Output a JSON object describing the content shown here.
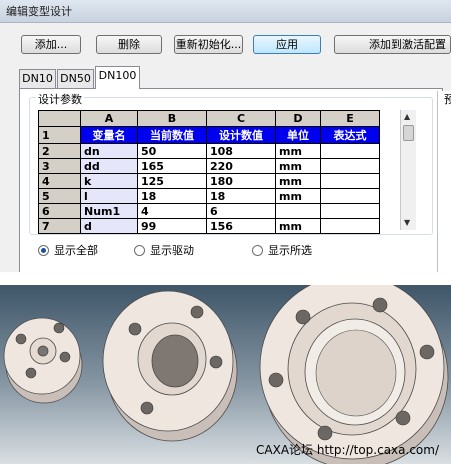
{
  "window": {
    "title": "编辑变型设计"
  },
  "toolbar": {
    "add_label": "添加...",
    "delete_label": "删除",
    "reinit_label": "重新初始化...",
    "apply_label": "应用",
    "add_to_active_label": "添加到激活配置"
  },
  "tabs": [
    "DN10",
    "DN50",
    "DN100"
  ],
  "active_tab": "DN100",
  "panel": {
    "group_label": "设计参数",
    "preview_label": "预"
  },
  "grid": {
    "columns": [
      "A",
      "B",
      "C",
      "D",
      "E"
    ],
    "header_row": {
      "index": "1",
      "cells": [
        "变量名",
        "当前数值",
        "设计数值",
        "单位",
        "表达式"
      ]
    },
    "rows": [
      {
        "index": "2",
        "cells": [
          "dn",
          "50",
          "108",
          "mm",
          ""
        ]
      },
      {
        "index": "3",
        "cells": [
          "dd",
          "165",
          "220",
          "mm",
          ""
        ]
      },
      {
        "index": "4",
        "cells": [
          "k",
          "125",
          "180",
          "mm",
          ""
        ]
      },
      {
        "index": "5",
        "cells": [
          "l",
          "18",
          "18",
          "mm",
          ""
        ]
      },
      {
        "index": "6",
        "cells": [
          "Num1",
          "4",
          "6",
          "",
          ""
        ]
      },
      {
        "index": "7",
        "cells": [
          "d",
          "99",
          "156",
          "mm",
          ""
        ]
      }
    ]
  },
  "display_options": {
    "show_all": "显示全部",
    "show_driven": "显示驱动",
    "show_selected": "显示所选",
    "selected": "show_all"
  },
  "caption": "CAXA论坛 http://top.caxa.com/",
  "colors": {
    "header_blue": "#0000ee",
    "flange_fill": "#efe6df",
    "flange_edge": "#4a4a4a"
  }
}
